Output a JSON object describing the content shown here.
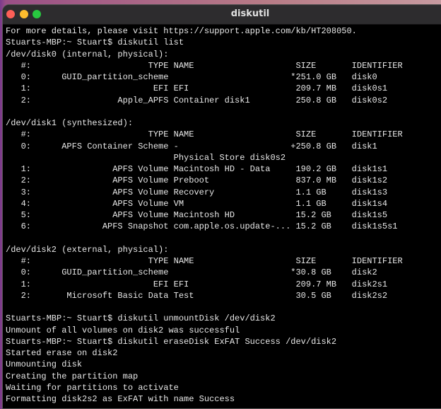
{
  "window": {
    "title": "diskutil"
  },
  "colors": {
    "close": "#fe5f57",
    "minimize": "#febc2e",
    "zoom": "#28c840",
    "terminal_bg": "#000000",
    "terminal_fg": "#e8e8e8"
  },
  "terminal": {
    "lines": [
      "For more details, please visit https://support.apple.com/kb/HT208050.",
      "Stuarts-MBP:~ Stuart$ diskutil list",
      "/dev/disk0 (internal, physical):",
      "   #:                       TYPE NAME                    SIZE       IDENTIFIER",
      "   0:      GUID_partition_scheme                        *251.0 GB   disk0",
      "   1:                        EFI EFI                     209.7 MB   disk0s1",
      "   2:                 Apple_APFS Container disk1         250.8 GB   disk0s2",
      "",
      "/dev/disk1 (synthesized):",
      "   #:                       TYPE NAME                    SIZE       IDENTIFIER",
      "   0:      APFS Container Scheme -                      +250.8 GB   disk1",
      "                                 Physical Store disk0s2",
      "   1:                APFS Volume Macintosh HD - Data     190.2 GB   disk1s1",
      "   2:                APFS Volume Preboot                 837.0 MB   disk1s2",
      "   3:                APFS Volume Recovery                1.1 GB     disk1s3",
      "   4:                APFS Volume VM                      1.1 GB     disk1s4",
      "   5:                APFS Volume Macintosh HD            15.2 GB    disk1s5",
      "   6:              APFS Snapshot com.apple.os.update-... 15.2 GB    disk1s5s1",
      "",
      "/dev/disk2 (external, physical):",
      "   #:                       TYPE NAME                    SIZE       IDENTIFIER",
      "   0:      GUID_partition_scheme                        *30.8 GB    disk2",
      "   1:                        EFI EFI                     209.7 MB   disk2s1",
      "   2:       Microsoft Basic Data Test                    30.5 GB    disk2s2",
      "",
      "Stuarts-MBP:~ Stuart$ diskutil unmountDisk /dev/disk2",
      "Unmount of all volumes on disk2 was successful",
      "Stuarts-MBP:~ Stuart$ diskutil eraseDisk ExFAT Success /dev/disk2",
      "Started erase on disk2",
      "Unmounting disk",
      "Creating the partition map",
      "Waiting for partitions to activate",
      "Formatting disk2s2 as ExFAT with name Success"
    ]
  }
}
